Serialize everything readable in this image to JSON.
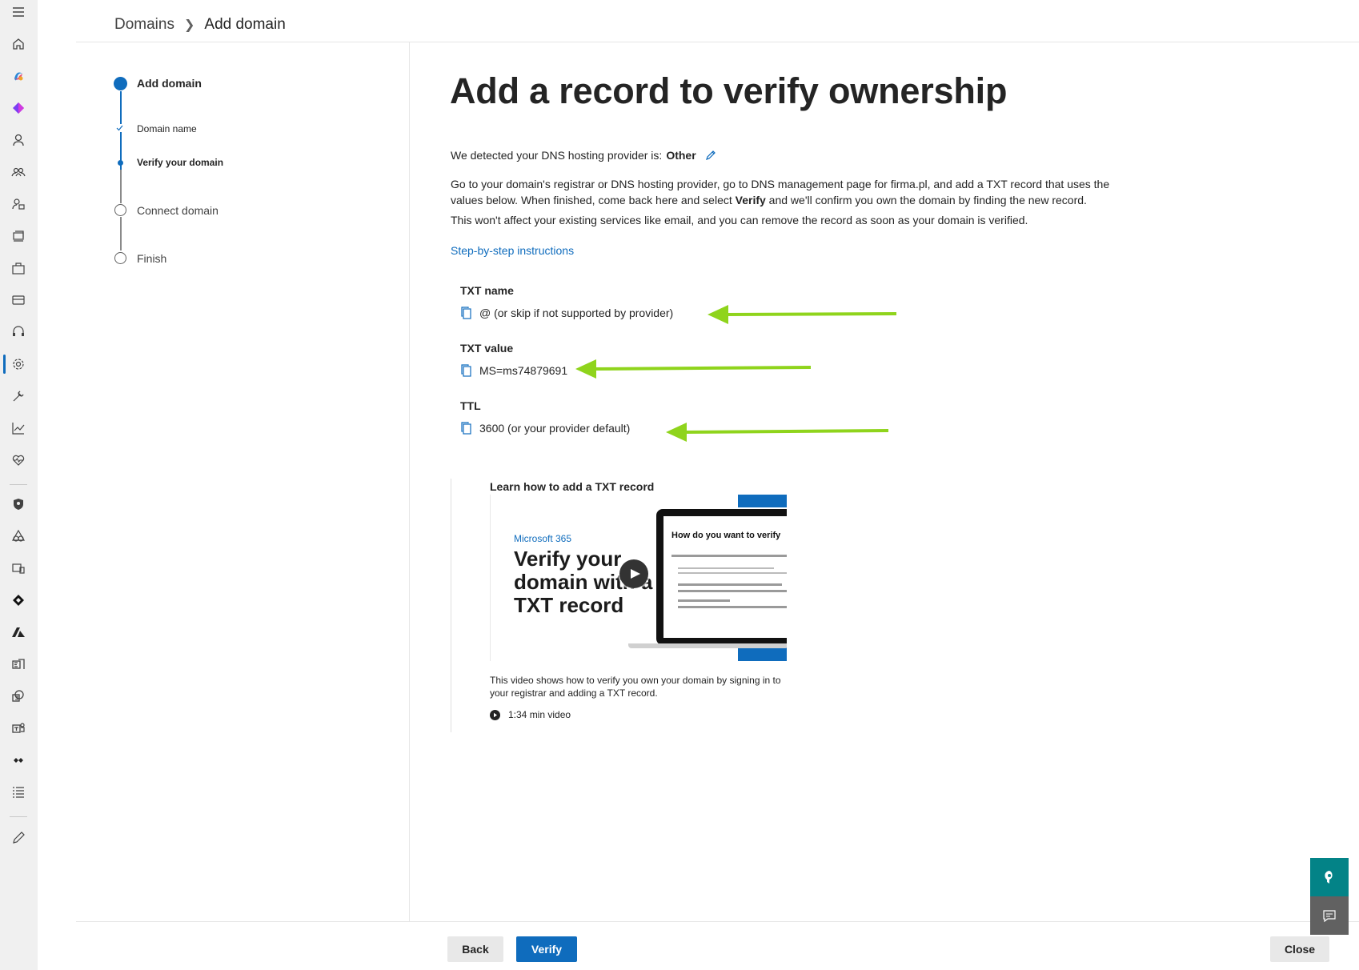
{
  "rail": {
    "icons": [
      "menu-icon",
      "home-icon",
      "copilot-icon",
      "loop-icon",
      "user-icon",
      "group-icon",
      "roles-icon",
      "resources-icon",
      "billing-bag-icon",
      "billing-card-icon",
      "support-icon",
      "settings-icon",
      "setup-icon",
      "reports-icon",
      "health-icon",
      "security-icon",
      "compliance-icon",
      "endpoint-icon",
      "identity-icon",
      "azure-icon",
      "exchange-icon",
      "sharepoint-icon",
      "teams-icon",
      "viva-icon",
      "all-admin-centers-icon",
      "customize-icon"
    ],
    "active": "settings-icon"
  },
  "breadcrumb": {
    "parent": "Domains",
    "current": "Add domain"
  },
  "steps": {
    "items": [
      {
        "label": "Add domain",
        "state": "current-section"
      },
      {
        "label": "Domain name",
        "state": "completed"
      },
      {
        "label": "Verify your domain",
        "state": "current"
      },
      {
        "label": "Connect domain",
        "state": "pending"
      },
      {
        "label": "Finish",
        "state": "pending"
      }
    ]
  },
  "main": {
    "title": "Add a record to verify ownership",
    "detected_prefix": "We detected your DNS hosting provider is:",
    "detected_value": "Other",
    "para1_a": "Go to your domain's registrar or DNS hosting provider, go to DNS management page for firma.pl, and add a TXT record that uses the values below. When finished, come back here and select ",
    "para1_bold": "Verify",
    "para1_b": " and we'll confirm you own the domain by finding the new record.",
    "para2": "This won't affect your existing services like email, and you can remove the record as soon as your domain is verified.",
    "instructions_link": "Step-by-step instructions",
    "records": [
      {
        "label": "TXT name",
        "value": "@ (or skip if not supported by provider)"
      },
      {
        "label": "TXT value",
        "value": "MS=ms74879691"
      },
      {
        "label": "TTL",
        "value": "3600 (or your provider default)"
      }
    ],
    "arrow_color": "#8fd41c"
  },
  "video": {
    "title": "Learn how to add a TXT record",
    "thumb_brand": "Microsoft 365",
    "thumb_heading": "Verify your domain with a TXT record",
    "thumb_screen_title": "How do you want to verify",
    "description": "This video shows how to verify you own your domain by signing in to your registrar and adding a TXT record.",
    "duration": "1:34 min video"
  },
  "footer": {
    "back_label": "Back",
    "verify_label": "Verify",
    "close_label": "Close"
  },
  "colors": {
    "accent": "#0f6cbd",
    "help_teal": "#038387",
    "feedback_gray": "#616161"
  }
}
